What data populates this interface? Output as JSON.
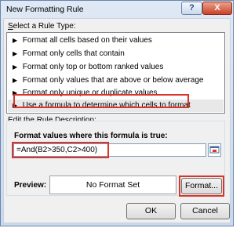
{
  "window": {
    "title": "New Formatting Rule",
    "help_glyph": "?",
    "close_glyph": "X"
  },
  "select_section": {
    "label": "Select a Rule Type:",
    "accel": "S"
  },
  "rule_types": [
    {
      "label": "Format all cells based on their values",
      "selected": false
    },
    {
      "label": "Format only cells that contain",
      "selected": false
    },
    {
      "label": "Format only top or bottom ranked values",
      "selected": false
    },
    {
      "label": "Format only values that are above or below average",
      "selected": false
    },
    {
      "label": "Format only unique or duplicate values",
      "selected": false
    },
    {
      "label": "Use a formula to determine which cells to format",
      "selected": true
    }
  ],
  "edit_section": {
    "label": "Edit the Rule Description:",
    "formula_label": "Format values where this formula is true:",
    "formula_value": "=And(B2>350,C2>400)"
  },
  "preview": {
    "label": "Preview:",
    "text": "No Format Set"
  },
  "buttons": {
    "format": "Format...",
    "ok": "OK",
    "cancel": "Cancel"
  },
  "colors": {
    "highlight": "#d9362b",
    "title_gradient_top": "#dfe9f5",
    "close_button": "#c94227"
  },
  "icons": {
    "rule_bullet": "▶",
    "range_selector": "collapse-dialog-icon"
  }
}
